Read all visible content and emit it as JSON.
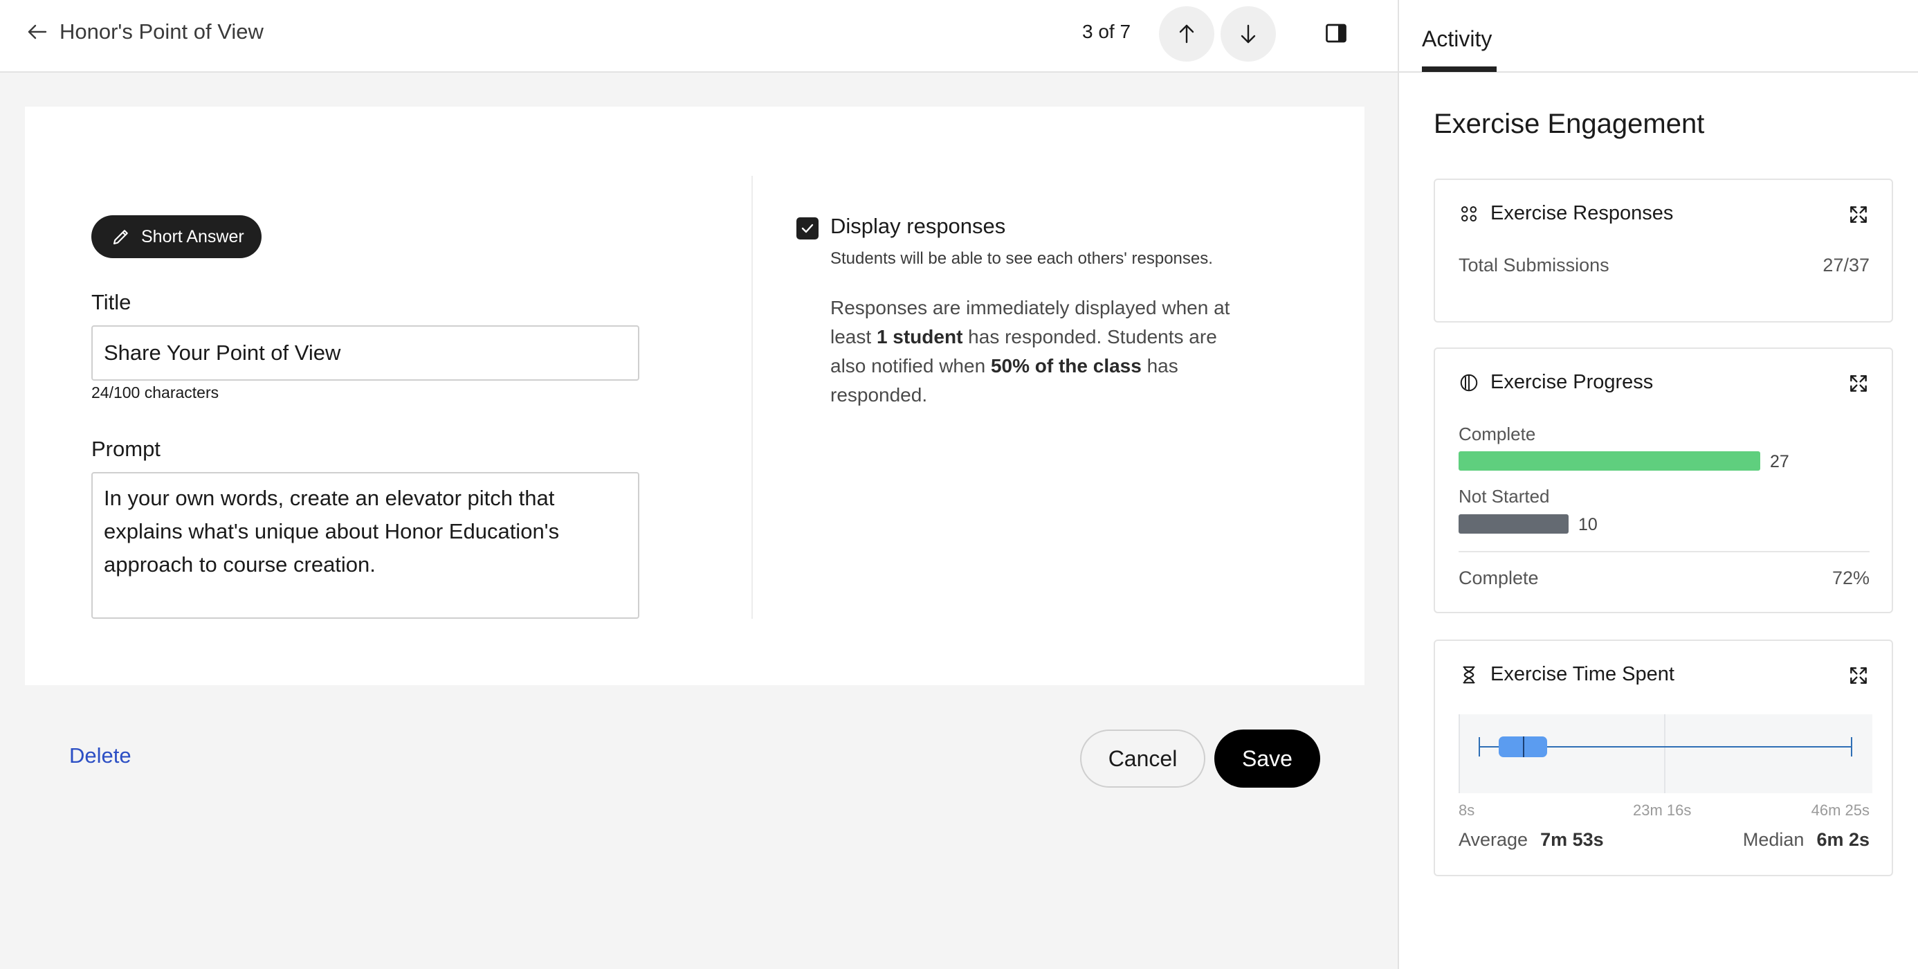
{
  "header": {
    "back_title": "Honor's Point of View",
    "pager": "3 of 7"
  },
  "editor": {
    "chip_label": "Short Answer",
    "title_label": "Title",
    "title_value": "Share Your Point of View",
    "title_counter": "24/100 characters",
    "prompt_label": "Prompt",
    "prompt_value": "In your own words, create an elevator pitch that explains what's unique about Honor Education's approach to course creation.",
    "display_responses": {
      "checked": true,
      "label": "Display responses",
      "help": "Students will be able to see each others' responses.",
      "desc_1": "Responses are immediately displayed when at least ",
      "desc_bold_1": "1 student",
      "desc_2": " has responded. Students are also notified when ",
      "desc_bold_2": "50% of the class",
      "desc_3": " has responded."
    }
  },
  "actions": {
    "delete": "Delete",
    "cancel": "Cancel",
    "save": "Save"
  },
  "sidebar": {
    "tab": "Activity",
    "title": "Exercise Engagement",
    "responses_card": {
      "title": "Exercise Responses",
      "row_label": "Total Submissions",
      "row_value": "27/37"
    },
    "progress_card": {
      "title": "Exercise Progress",
      "complete_label": "Complete",
      "complete_count": 27,
      "not_started_label": "Not Started",
      "not_started_count": 10,
      "summary_label": "Complete",
      "summary_value": "72%",
      "complete_color": "#5fcf7e",
      "not_started_color": "#646a72"
    },
    "time_card": {
      "title": "Exercise Time Spent",
      "axis_min": "8s",
      "axis_mid": "23m 16s",
      "axis_max": "46m 25s",
      "average_label": "Average",
      "average_value": "7m 53s",
      "median_label": "Median",
      "median_value": "6m 2s",
      "box_color": "#5b9cf0"
    }
  }
}
